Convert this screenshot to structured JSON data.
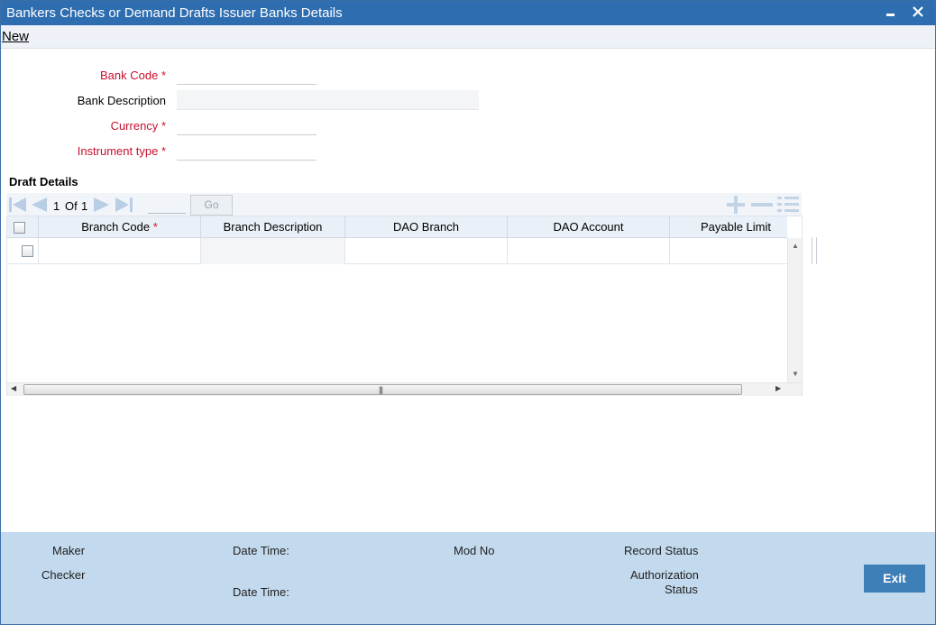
{
  "window": {
    "title": "Bankers Checks or Demand Drafts Issuer Banks Details",
    "minimize_glyph": "▬",
    "close_glyph": "✕"
  },
  "menu": {
    "new_label": "New"
  },
  "form": {
    "bank_code_label": "Bank Code",
    "bank_description_label": "Bank Description",
    "currency_label": "Currency",
    "instrument_type_label": "Instrument type",
    "required_marker": "*",
    "bank_code_value": "",
    "bank_description_value": "",
    "currency_value": "",
    "instrument_type_value": ""
  },
  "draft_details": {
    "section_title": "Draft Details",
    "pagination": {
      "current": "1",
      "of_label": "Of",
      "total": "1",
      "go_label": "Go"
    },
    "columns": {
      "branch_code": "Branch Code",
      "branch_description": "Branch Description",
      "dao_branch": "DAO Branch",
      "dao_account": "DAO Account",
      "payable_limit": "Payable Limit"
    },
    "rows": [
      {
        "branch_code": "",
        "branch_description": "",
        "dao_branch": "",
        "dao_account": "",
        "payable_limit": ""
      }
    ]
  },
  "footer": {
    "maker_label": "Maker",
    "checker_label": "Checker",
    "date_time_label_1": "Date Time:",
    "date_time_label_2": "Date Time:",
    "mod_no_label": "Mod No",
    "record_status_label": "Record Status",
    "authorization_label": "Authorization",
    "status_label": "Status",
    "exit_label": "Exit"
  },
  "colors": {
    "title_bar": "#2e6db0",
    "required": "#c8102e",
    "footer_bg": "#c3d9ee",
    "exit_button": "#3f7fb8"
  }
}
